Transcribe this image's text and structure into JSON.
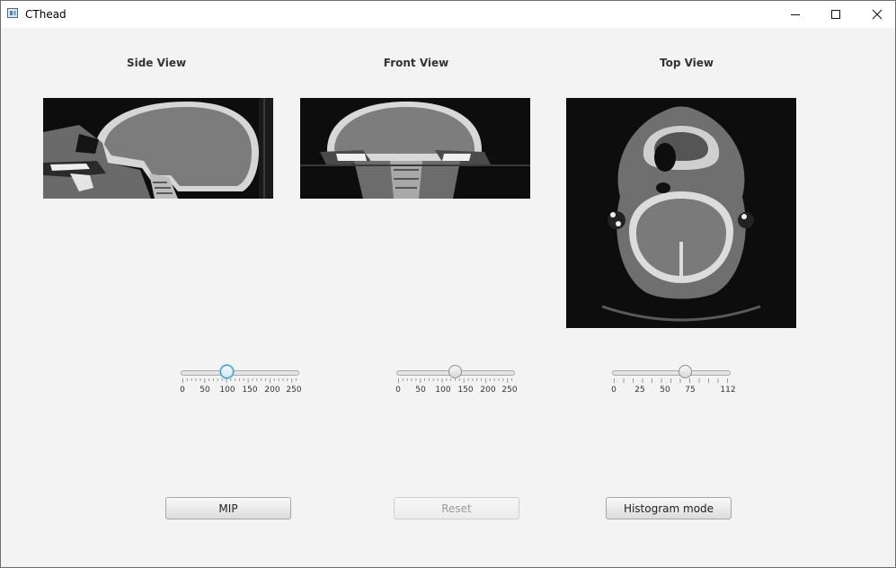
{
  "window": {
    "title": "CThead"
  },
  "views": [
    {
      "title": "Side View",
      "image": "sagittal-ct-slice"
    },
    {
      "title": "Front View",
      "image": "coronal-ct-slice"
    },
    {
      "title": "Top View",
      "image": "axial-ct-slice"
    }
  ],
  "sliders": [
    {
      "name": "side",
      "min": 0,
      "max": 255,
      "value": 100,
      "focused": true,
      "tick_labels": [
        "0",
        "50",
        "100",
        "150",
        "200",
        "250"
      ]
    },
    {
      "name": "front",
      "min": 0,
      "max": 255,
      "value": 128,
      "focused": false,
      "tick_labels": [
        "0",
        "50",
        "100",
        "150",
        "200",
        "250"
      ]
    },
    {
      "name": "top",
      "min": 0,
      "max": 112,
      "value": 70,
      "focused": false,
      "tick_labels": [
        "0",
        "25",
        "50",
        "75",
        "112"
      ]
    }
  ],
  "buttons": {
    "mip": "MIP",
    "reset": "Reset",
    "histogram": "Histogram mode"
  }
}
